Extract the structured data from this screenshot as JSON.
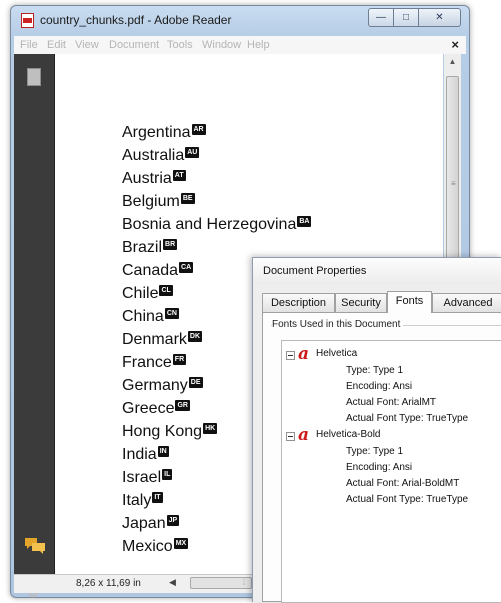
{
  "window": {
    "title": "country_chunks.pdf - Adobe Reader",
    "min_glyph": "—",
    "max_glyph": "□",
    "close_glyph": "✕"
  },
  "menu": [
    "File",
    "Edit",
    "View",
    "Document",
    "Tools",
    "Window",
    "Help"
  ],
  "menu_close": "×",
  "countries": [
    {
      "name": "Argentina",
      "code": "AR"
    },
    {
      "name": "Australia",
      "code": "AU"
    },
    {
      "name": "Austria",
      "code": "AT"
    },
    {
      "name": "Belgium",
      "code": "BE"
    },
    {
      "name": "Bosnia and Herzegovina",
      "code": "BA"
    },
    {
      "name": "Brazil",
      "code": "BR"
    },
    {
      "name": "Canada",
      "code": "CA"
    },
    {
      "name": "Chile",
      "code": "CL"
    },
    {
      "name": "China",
      "code": "CN"
    },
    {
      "name": "Denmark",
      "code": "DK"
    },
    {
      "name": "France",
      "code": "FR"
    },
    {
      "name": "Germany",
      "code": "DE"
    },
    {
      "name": "Greece",
      "code": "GR"
    },
    {
      "name": "Hong Kong",
      "code": "HK"
    },
    {
      "name": "India",
      "code": "IN"
    },
    {
      "name": "Israel",
      "code": "IL"
    },
    {
      "name": "Italy",
      "code": "IT"
    },
    {
      "name": "Japan",
      "code": "JP"
    },
    {
      "name": "Mexico",
      "code": "MX"
    }
  ],
  "statusbar": {
    "page_size": "8,26 x 11,69 in"
  },
  "dialog": {
    "title": "Document Properties",
    "tabs": [
      "Description",
      "Security",
      "Fonts",
      "Advanced"
    ],
    "active_tab": "Fonts",
    "group_label": "Fonts Used in this Document",
    "fonts": [
      {
        "name": "Helvetica",
        "type": "Type: Type 1",
        "encoding": "Encoding: Ansi",
        "actual_font": "Actual Font: ArialMT",
        "actual_font_type": "Actual Font Type: TrueType"
      },
      {
        "name": "Helvetica-Bold",
        "type": "Type: Type 1",
        "encoding": "Encoding: Ansi",
        "actual_font": "Actual Font: Arial-BoldMT",
        "actual_font_type": "Actual Font Type: TrueType"
      }
    ]
  },
  "icons": {
    "app": "pdf-file-icon",
    "pages": "page-thumbnail-icon",
    "comments": "comment-bubbles-icon",
    "attachments": "paperclip-icon",
    "font": "font-type-icon",
    "expander": "collapse-minus-icon"
  },
  "colors": {
    "nav_panel": "#3b3b3b",
    "font_icon": "#cc1a1a",
    "title_bar": "#c9dcf0"
  }
}
